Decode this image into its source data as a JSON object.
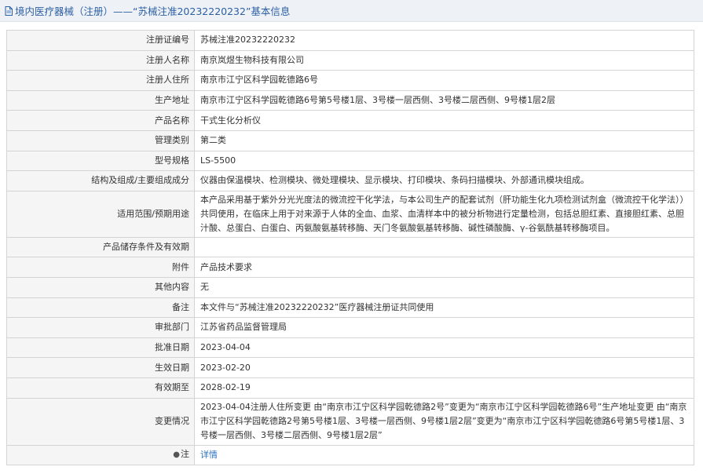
{
  "header": {
    "title": "境内医疗器械（注册）——“苏械注准20232220232”基本信息"
  },
  "rows": [
    {
      "label": "注册证编号",
      "value": "苏械注准20232220232"
    },
    {
      "label": "注册人名称",
      "value": "南京岚煜生物科技有限公司"
    },
    {
      "label": "注册人住所",
      "value": "南京市江宁区科学园乾德路6号"
    },
    {
      "label": "生产地址",
      "value": "南京市江宁区科学园乾德路6号第5号楼1层、3号楼一层西侧、3号楼二层西侧、9号楼1层2层"
    },
    {
      "label": "产品名称",
      "value": "干式生化分析仪"
    },
    {
      "label": "管理类别",
      "value": "第二类"
    },
    {
      "label": "型号规格",
      "value": "LS-5500"
    },
    {
      "label": "结构及组成/主要组成成分",
      "value": "仪器由保温模块、检测模块、微处理模块、显示模块、打印模块、条码扫描模块、外部通讯模块组成。"
    },
    {
      "label": "适用范围/预期用途",
      "value": "本产品采用基于紫外分光光度法的微流控干化学法，与本公司生产的配套试剂（肝功能生化九项检测试剂盒（微流控干化学法））共同使用，在临床上用于对来源于人体的全血、血浆、血清样本中的被分析物进行定量检测，包括总胆红素、直接胆红素、总胆汁酸、总蛋白、白蛋白、丙氨酸氨基转移酶、天门冬氨酸氨基转移酶、碱性磷酸酶、γ-谷氨酰基转移酶项目。"
    },
    {
      "label": "产品储存条件及有效期",
      "value": ""
    },
    {
      "label": "附件",
      "value": "产品技术要求"
    },
    {
      "label": "其他内容",
      "value": "无"
    },
    {
      "label": "备注",
      "value": "本文件与“苏械注准20232220232”医疗器械注册证共同使用"
    },
    {
      "label": "审批部门",
      "value": "江苏省药品监督管理局"
    },
    {
      "label": "批准日期",
      "value": "2023-04-04"
    },
    {
      "label": "生效日期",
      "value": "2023-02-20"
    },
    {
      "label": "有效期至",
      "value": "2028-02-19"
    },
    {
      "label": "变更情况",
      "value": "2023-04-04注册人住所变更 由“南京市江宁区科学园乾德路2号”变更为“南京市江宁区科学园乾德路6号”生产地址变更 由“南京市江宁区科学园乾德路2号第5号楼1层、3号楼一层西侧、9号楼1层2层”变更为“南京市江宁区科学园乾德路6号第5号楼1层、3号楼一层西侧、3号楼二层西侧、9号楼1层2层”"
    }
  ],
  "note": {
    "icon": "pin-icon",
    "label": "注",
    "link_text": "详情"
  }
}
